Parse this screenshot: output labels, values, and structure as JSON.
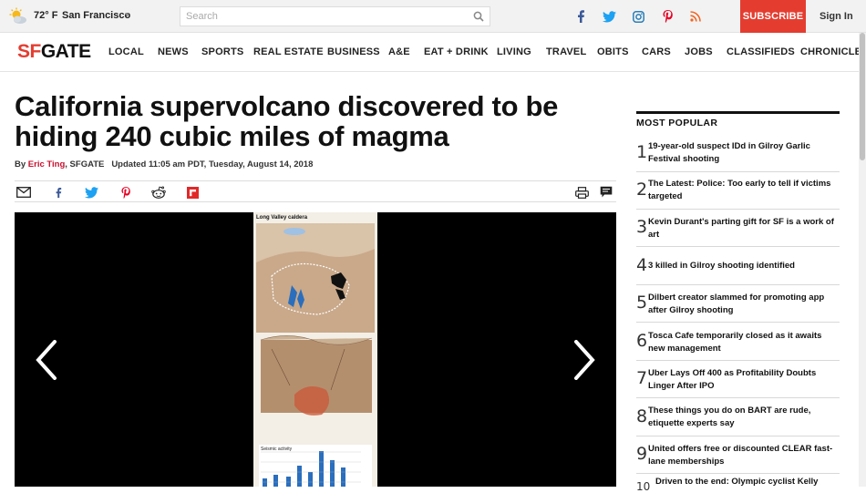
{
  "topbar": {
    "temperature": "72° F",
    "city": "San Francisco",
    "search_placeholder": "Search",
    "subscribe_label": "SUBSCRIBE",
    "signin_label": "Sign In",
    "social": [
      {
        "icon": "facebook-icon",
        "glyph": "f",
        "color": "#3b5998"
      },
      {
        "icon": "twitter-icon",
        "glyph": "t",
        "color": "#1da1f2"
      },
      {
        "icon": "instagram-icon",
        "glyph": "i",
        "color": "#2a7fb8"
      },
      {
        "icon": "pinterest-icon",
        "glyph": "p",
        "color": "#e60023"
      },
      {
        "icon": "rss-icon",
        "glyph": "r",
        "color": "#f26522"
      }
    ]
  },
  "nav": {
    "logo_sf": "SF",
    "logo_gate": "GATE",
    "items": [
      "LOCAL",
      "NEWS",
      "SPORTS",
      "REAL ESTATE",
      "BUSINESS",
      "A&E",
      "EAT + DRINK",
      "LIVING",
      "TRAVEL",
      "OBITS",
      "CARS",
      "JOBS",
      "CLASSIFIEDS",
      "CHRONICLE"
    ]
  },
  "article": {
    "headline": "California supervolcano discovered to be hiding 240 cubic miles of magma",
    "by": "By",
    "author": "Eric Ting",
    "outlet": ", SFGATE",
    "updated": "Updated 11:05 am PDT, Tuesday, August 14, 2018"
  },
  "gallery": {
    "figure_title": "Long Valley caldera",
    "figure_caption": "Seismic activity"
  },
  "most_popular": {
    "title": "MOST POPULAR",
    "items": [
      {
        "num": "1",
        "text": "19-year-old suspect IDd in Gilroy Garlic Festival shooting"
      },
      {
        "num": "2",
        "text": "The Latest: Police: Too early to tell if victims targeted"
      },
      {
        "num": "3",
        "text": "Kevin Durant's parting gift for SF is a work of art"
      },
      {
        "num": "4",
        "text": "3 killed in Gilroy shooting identified"
      },
      {
        "num": "5",
        "text": "Dilbert creator slammed for promoting app after Gilroy shooting"
      },
      {
        "num": "6",
        "text": "Tosca Cafe temporarily closed as it awaits new management"
      },
      {
        "num": "7",
        "text": "Uber Lays Off 400 as Profitability Doubts Linger After IPO"
      },
      {
        "num": "8",
        "text": "These things you do on BART are rude, etiquette experts say"
      },
      {
        "num": "9",
        "text": "United offers free or discounted CLEAR fast-lane memberships"
      },
      {
        "num": "10",
        "text": "Driven to the end: Olympic cyclist Kelly"
      }
    ]
  },
  "colors": {
    "brand_red": "#e43d30",
    "author_red": "#c8102e"
  }
}
